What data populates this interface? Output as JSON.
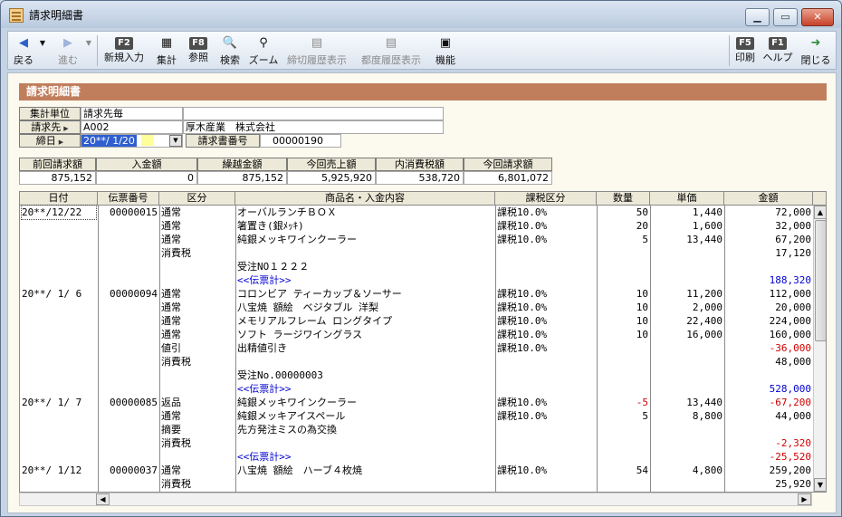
{
  "window": {
    "title": "請求明細書",
    "min": "▁",
    "max": "▭",
    "close": "✕"
  },
  "toolbar": {
    "back": "戻る",
    "forward": "進む",
    "new_label": "新規入力",
    "new_key": "F2",
    "total_label": "集計",
    "ref_label": "参照",
    "ref_key": "F8",
    "search_label": "検索",
    "zoom_label": "ズーム",
    "closing_history": "締切履歴表示",
    "each_history": "都度履歴表示",
    "function_label": "機能",
    "print_label": "印刷",
    "print_key": "F5",
    "help_label": "ヘルプ",
    "help_key": "F1",
    "close_label": "閉じる"
  },
  "header": {
    "section_title": "請求明細書",
    "unit_label": "集計単位",
    "unit_value": "請求先毎",
    "billto_label": "請求先",
    "billto_code": "A002",
    "billto_name": "厚木産業　株式会社",
    "closing_label": "締日",
    "closing_value": "20**/ 1/20",
    "invoice_no_label": "請求書番号",
    "invoice_no_value": "00000190"
  },
  "summary": {
    "labels": [
      "前回請求額",
      "入金額",
      "繰越金額",
      "今回売上額",
      "内消費税額",
      "今回請求額"
    ],
    "values": [
      "875,152",
      "0",
      "875,152",
      "5,925,920",
      "538,720",
      "6,801,072"
    ]
  },
  "grid": {
    "columns": [
      "日付",
      "伝票番号",
      "区分",
      "商品名・入金内容",
      "課税区分",
      "数量",
      "単価",
      "金額"
    ],
    "rows": [
      {
        "date": "20**/12/22",
        "slip": "00000015",
        "kubun": "通常",
        "item": "オーバルランチＢＯＸ",
        "tax": "課税10.0%",
        "qty": "50",
        "price": "1,440",
        "amount": "72,000"
      },
      {
        "date": "",
        "slip": "",
        "kubun": "通常",
        "item": "箸置き(銀ﾒｯｷ)",
        "tax": "課税10.0%",
        "qty": "20",
        "price": "1,600",
        "amount": "32,000"
      },
      {
        "date": "",
        "slip": "",
        "kubun": "通常",
        "item": "純銀メッキワインクーラー",
        "tax": "課税10.0%",
        "qty": "5",
        "price": "13,440",
        "amount": "67,200"
      },
      {
        "date": "",
        "slip": "",
        "kubun": "消費税",
        "item": "",
        "tax": "",
        "qty": "",
        "price": "",
        "amount": "17,120"
      },
      {
        "date": "",
        "slip": "",
        "kubun": "",
        "item": "受注NO１２２２",
        "tax": "",
        "qty": "",
        "price": "",
        "amount": ""
      },
      {
        "date": "",
        "slip": "",
        "kubun": "",
        "item": "<<伝票計>>",
        "tax": "",
        "qty": "",
        "price": "",
        "amount": "188,320",
        "style": "blue"
      },
      {
        "date": "20**/ 1/ 6",
        "slip": "00000094",
        "kubun": "通常",
        "item": "コロンビア ティーカップ＆ソーサー",
        "tax": "課税10.0%",
        "qty": "10",
        "price": "11,200",
        "amount": "112,000"
      },
      {
        "date": "",
        "slip": "",
        "kubun": "通常",
        "item": "八宝焼 額絵　ベジタブル 洋梨",
        "tax": "課税10.0%",
        "qty": "10",
        "price": "2,000",
        "amount": "20,000"
      },
      {
        "date": "",
        "slip": "",
        "kubun": "通常",
        "item": "メモリアルフレーム ロングタイプ",
        "tax": "課税10.0%",
        "qty": "10",
        "price": "22,400",
        "amount": "224,000"
      },
      {
        "date": "",
        "slip": "",
        "kubun": "通常",
        "item": "ソフト ラージワイングラス",
        "tax": "課税10.0%",
        "qty": "10",
        "price": "16,000",
        "amount": "160,000"
      },
      {
        "date": "",
        "slip": "",
        "kubun": "値引",
        "item": "出精値引き",
        "tax": "課税10.0%",
        "qty": "",
        "price": "",
        "amount": "-36,000",
        "style": "red"
      },
      {
        "date": "",
        "slip": "",
        "kubun": "消費税",
        "item": "",
        "tax": "",
        "qty": "",
        "price": "",
        "amount": "48,000"
      },
      {
        "date": "",
        "slip": "",
        "kubun": "",
        "item": "受注No.00000003",
        "tax": "",
        "qty": "",
        "price": "",
        "amount": ""
      },
      {
        "date": "",
        "slip": "",
        "kubun": "",
        "item": "<<伝票計>>",
        "tax": "",
        "qty": "",
        "price": "",
        "amount": "528,000",
        "style": "blue"
      },
      {
        "date": "20**/ 1/ 7",
        "slip": "00000085",
        "kubun": "返品",
        "item": "純銀メッキワインクーラー",
        "tax": "課税10.0%",
        "qty": "-5",
        "price": "13,440",
        "amount": "-67,200",
        "style": "red"
      },
      {
        "date": "",
        "slip": "",
        "kubun": "通常",
        "item": "純銀メッキアイスペール",
        "tax": "課税10.0%",
        "qty": "5",
        "price": "8,800",
        "amount": "44,000"
      },
      {
        "date": "",
        "slip": "",
        "kubun": "摘要",
        "item": "先方発注ミスの為交換",
        "tax": "",
        "qty": "",
        "price": "",
        "amount": ""
      },
      {
        "date": "",
        "slip": "",
        "kubun": "消費税",
        "item": "",
        "tax": "",
        "qty": "",
        "price": "",
        "amount": "-2,320",
        "style": "red"
      },
      {
        "date": "",
        "slip": "",
        "kubun": "",
        "item": "<<伝票計>>",
        "tax": "",
        "qty": "",
        "price": "",
        "amount": "-25,520",
        "style": "blue-red"
      },
      {
        "date": "20**/ 1/12",
        "slip": "00000037",
        "kubun": "通常",
        "item": "八宝焼 額絵　ハーブ４枚焼",
        "tax": "課税10.0%",
        "qty": "54",
        "price": "4,800",
        "amount": "259,200"
      },
      {
        "date": "",
        "slip": "",
        "kubun": "消費税",
        "item": "",
        "tax": "",
        "qty": "",
        "price": "",
        "amount": "25,920"
      }
    ]
  },
  "colors": {
    "section_head": "#c07e5d",
    "negative": "#d00000",
    "subtotal": "#0000d0"
  }
}
